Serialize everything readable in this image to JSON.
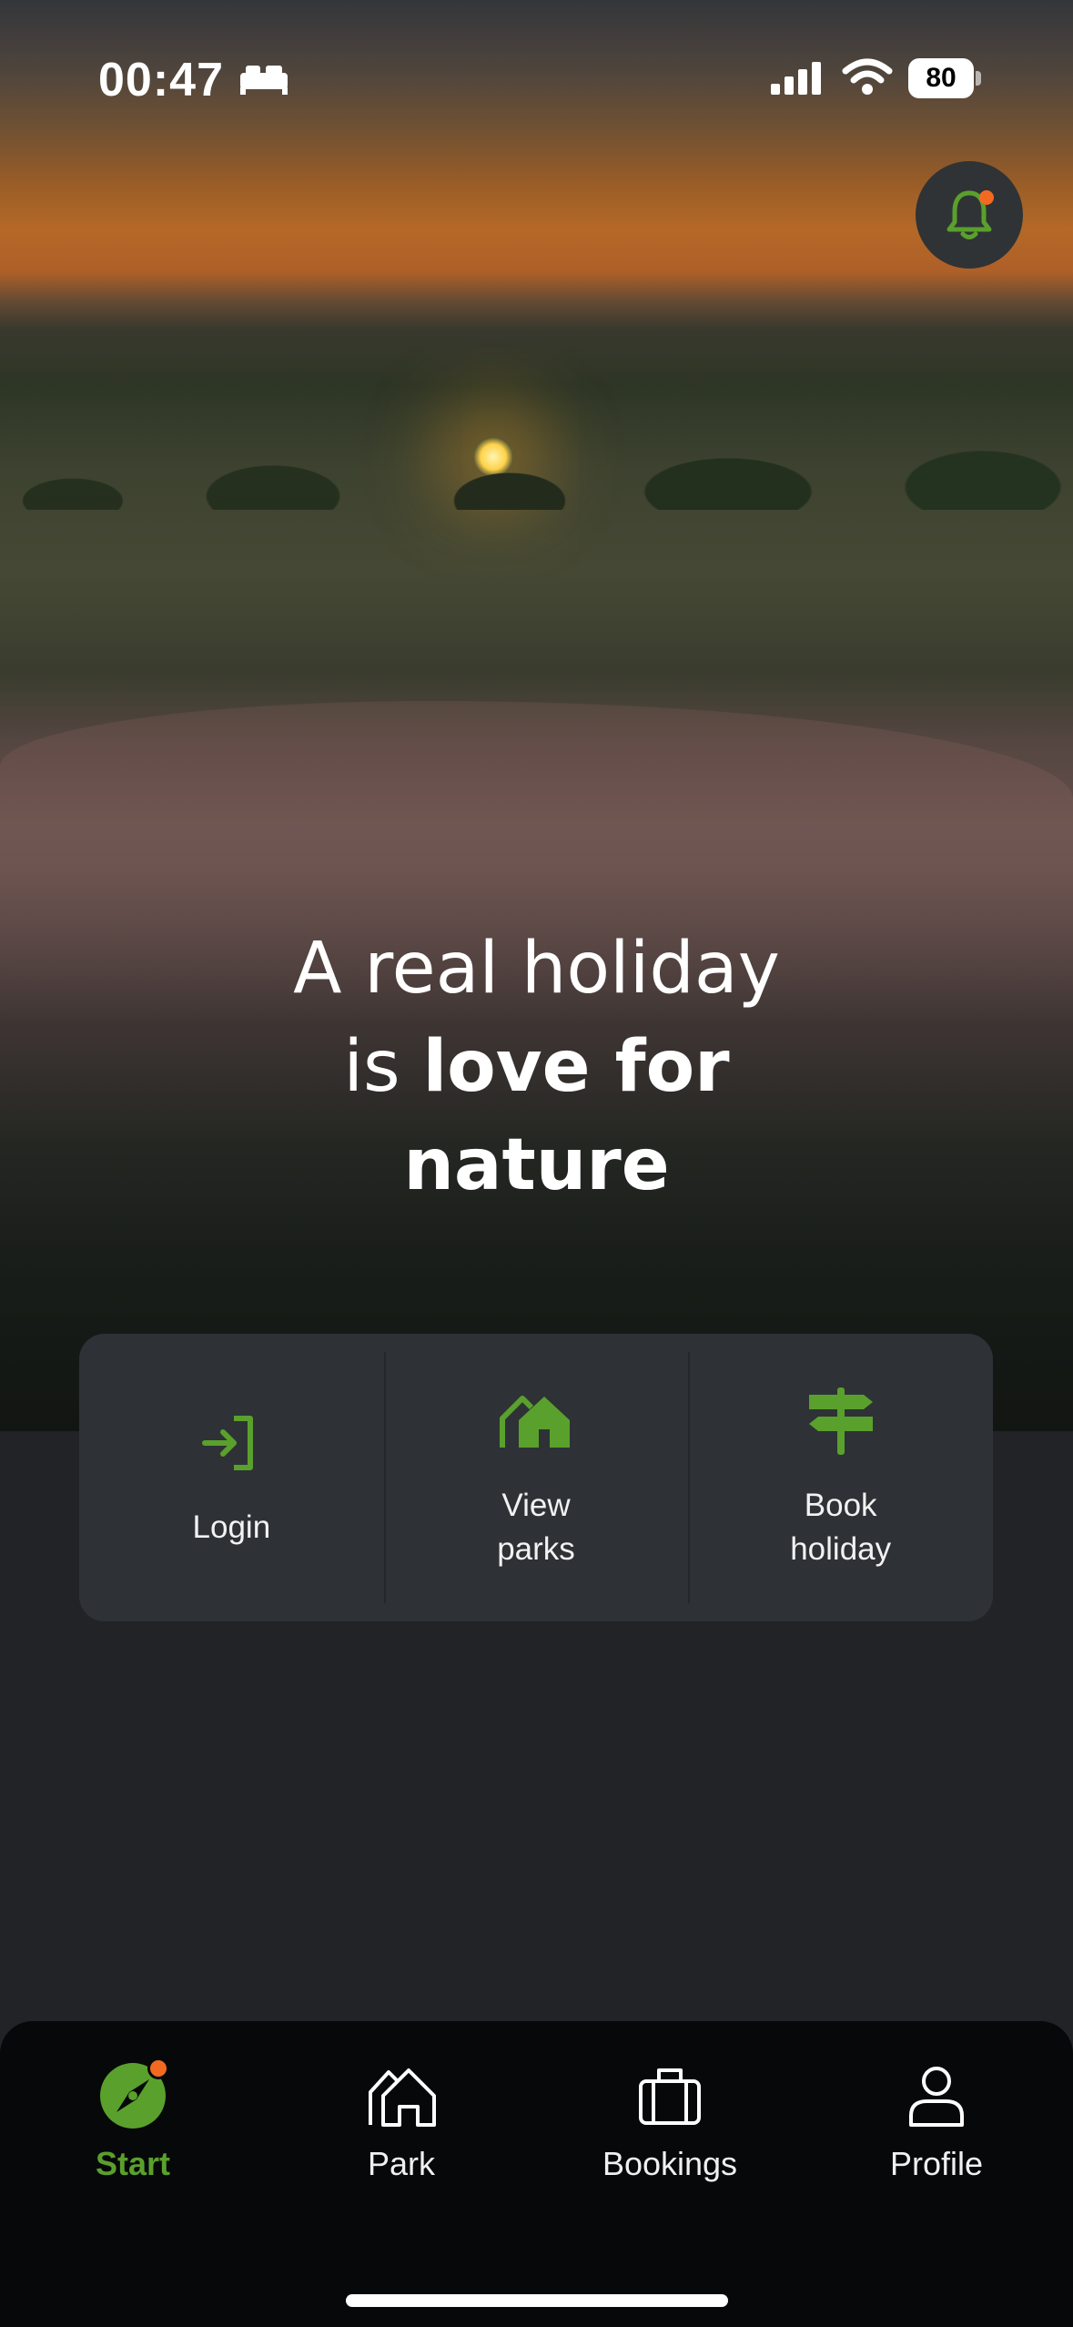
{
  "status_bar": {
    "time": "00:47",
    "battery": "80",
    "icons": [
      "bed-icon",
      "signal-icon",
      "wifi-icon",
      "battery-icon"
    ]
  },
  "notification": {
    "icon": "bell-icon",
    "has_badge": true
  },
  "hero": {
    "headline_line1": "A real holiday",
    "headline_line2_prefix": "is ",
    "headline_line2_bold": "love for",
    "headline_line3_bold": "nature"
  },
  "actions": [
    {
      "label": "Login",
      "icon": "login-icon"
    },
    {
      "label": "View\nparks",
      "icon": "house-icon"
    },
    {
      "label": "Book\nholiday",
      "icon": "signpost-icon"
    }
  ],
  "tabs": [
    {
      "label": "Start",
      "icon": "compass-icon",
      "active": true,
      "badge": true
    },
    {
      "label": "Park",
      "icon": "park-house-icon",
      "active": false
    },
    {
      "label": "Bookings",
      "icon": "suitcase-icon",
      "active": false
    },
    {
      "label": "Profile",
      "icon": "person-icon",
      "active": false
    }
  ],
  "colors": {
    "accent_green": "#5aa02c",
    "badge_orange": "#f26a22",
    "card_bg": "#2e3237",
    "page_bg": "#222326",
    "tabbar_bg": "#07080a"
  }
}
